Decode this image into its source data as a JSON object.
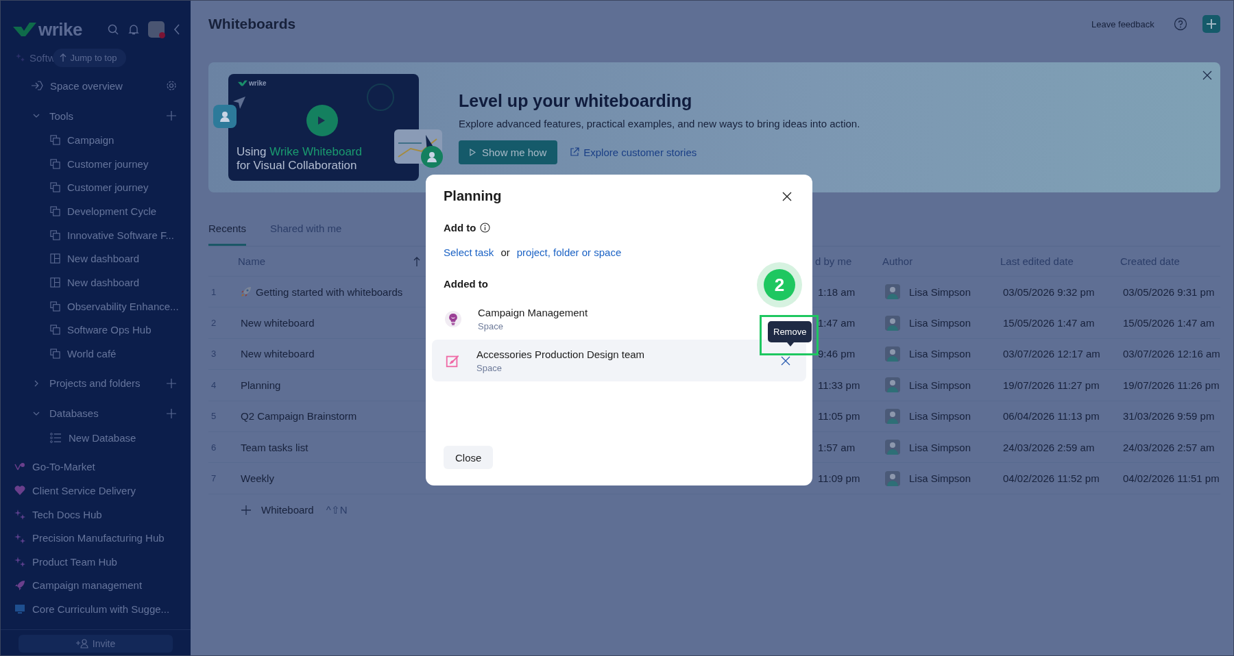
{
  "sidebar": {
    "logo": "wrike",
    "partial_space": "Softw",
    "jump_button": "Jump to top",
    "overview": "Space overview",
    "sections": [
      {
        "label": "Tools",
        "expanded": true,
        "children": [
          {
            "label": "Campaign",
            "kind": "whiteboard"
          },
          {
            "label": "Customer journey",
            "kind": "whiteboard"
          },
          {
            "label": "Customer journey",
            "kind": "whiteboard"
          },
          {
            "label": "Development Cycle",
            "kind": "whiteboard"
          },
          {
            "label": "Innovative Software F...",
            "kind": "whiteboard"
          },
          {
            "label": "New dashboard",
            "kind": "dashboard"
          },
          {
            "label": "New dashboard",
            "kind": "dashboard"
          },
          {
            "label": "Observability Enhance...",
            "kind": "whiteboard"
          },
          {
            "label": "Software Ops Hub",
            "kind": "whiteboard"
          },
          {
            "label": "World café",
            "kind": "whiteboard"
          }
        ]
      },
      {
        "label": "Projects and folders",
        "expanded": false
      },
      {
        "label": "Databases",
        "expanded": true,
        "children": [
          {
            "label": "New Database",
            "kind": "database"
          }
        ]
      }
    ],
    "spaces": [
      {
        "label": "Go-To-Market",
        "kind": "branch",
        "color": "#6a3f8c"
      },
      {
        "label": "Client Service Delivery",
        "kind": "heart",
        "color": "#6a3f8c"
      },
      {
        "label": "Tech Docs Hub",
        "kind": "sparkle",
        "color": "#5a3f8c"
      },
      {
        "label": "Precision Manufacturing Hub",
        "kind": "sparkle",
        "color": "#5a3f8c"
      },
      {
        "label": "Product Team Hub",
        "kind": "sparkle",
        "color": "#5a3f8c"
      },
      {
        "label": "Campaign management",
        "kind": "rocket",
        "color": "#6a3f8c"
      },
      {
        "label": "Core Curriculum with Sugge...",
        "kind": "monitor",
        "color": "#1e4f8f"
      }
    ],
    "invite": "Invite"
  },
  "header": {
    "title": "Whiteboards",
    "feedback": "Leave feedback"
  },
  "banner": {
    "video_logo": "wrike",
    "video_title_start": "Using",
    "video_title_highlight": "Wrike Whiteboard",
    "video_title_end": "for Visual Collaboration",
    "heading": "Level up your whiteboarding",
    "text": "Explore advanced features, practical examples, and new ways to bring ideas into action.",
    "button": "Show me how",
    "link": "Explore customer stories"
  },
  "tabs": [
    {
      "label": "Recents",
      "selected": true
    },
    {
      "label": "Shared with me",
      "selected": false
    }
  ],
  "table": {
    "columns": [
      "Name",
      "d by me",
      "Author",
      "Last edited date",
      "Created date"
    ],
    "rows": [
      {
        "num": "1",
        "kind": "starter",
        "name": "Getting started with whiteboards",
        "column_3": "1:18 am",
        "author": "Lisa Simpson",
        "last_edited": "03/05/2026 9:32 pm",
        "created": "03/05/2026 9:31 pm"
      },
      {
        "num": "2",
        "kind": "plain",
        "name": "New whiteboard",
        "column_3": "1:47 am",
        "author": "Lisa Simpson",
        "last_edited": "15/05/2026 1:47 am",
        "created": "15/05/2026 1:47 am"
      },
      {
        "num": "3",
        "kind": "plain",
        "name": "New whiteboard",
        "column_3": "9:46 pm",
        "author": "Lisa Simpson",
        "last_edited": "03/07/2026 12:17 am",
        "created": "03/07/2026 12:16 am"
      },
      {
        "num": "4",
        "kind": "plain",
        "name": "Planning",
        "column_3": "11:33 pm",
        "author": "Lisa Simpson",
        "last_edited": "19/07/2026 11:27 pm",
        "created": "19/07/2026 11:26 pm"
      },
      {
        "num": "5",
        "kind": "plain",
        "name": "Q2 Campaign Brainstorm",
        "column_3": "11:05 pm",
        "author": "Lisa Simpson",
        "last_edited": "06/04/2026 11:13 pm",
        "created": "31/03/2026 9:59 pm"
      },
      {
        "num": "6",
        "kind": "plain",
        "name": "Team tasks list",
        "column_3": "1:57 am",
        "author": "Lisa Simpson",
        "last_edited": "24/03/2026 2:59 am",
        "created": "24/03/2026 2:57 am"
      },
      {
        "num": "7",
        "kind": "plain",
        "name": "Weekly",
        "column_3": "11:09 pm",
        "author": "Lisa Simpson",
        "last_edited": "04/02/2026 11:52 pm",
        "created": "04/02/2026 11:51 pm"
      }
    ],
    "new_button": "Whiteboard",
    "shortcut": "^⇧N"
  },
  "dialog": {
    "title": "Planning",
    "add_to_label": "Add to",
    "select_task": "Select task",
    "or": "or",
    "other_link": "project, folder or space",
    "added_label": "Added to",
    "items": [
      {
        "name": "Campaign Management",
        "type": "Space",
        "kind": "bulb",
        "hovered": false
      },
      {
        "name": "Accessories Production Design team",
        "type": "Space",
        "kind": "brush",
        "hovered": true
      }
    ],
    "close": "Close"
  },
  "tooltip": "Remove",
  "step_badge": "2"
}
